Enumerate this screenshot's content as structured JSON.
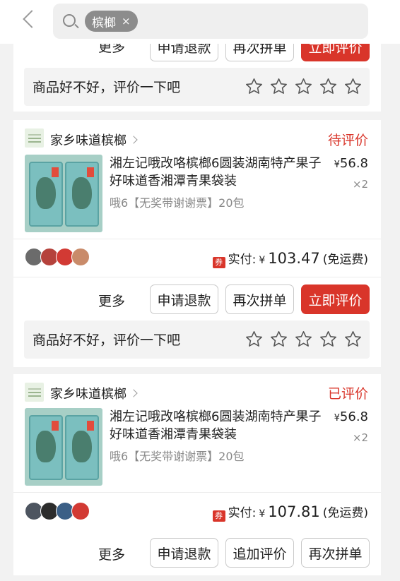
{
  "search": {
    "keyword": "槟榔",
    "clear": "×"
  },
  "top_card": {
    "more": "更多",
    "btn_refund": "申请退款",
    "btn_reorder": "再次拼单",
    "btn_review": "立即评价",
    "rate_prompt": "商品好不好，评价一下吧"
  },
  "orders": [
    {
      "shop_name": "家乡味道槟榔",
      "status": "待评价",
      "title": "湘左记哦改咯槟榔6圆装湖南特产果子好味道香湘潭青果袋装",
      "sku": "哦6【无奖带谢谢票】20包",
      "price_symbol": "¥",
      "price": "56.8",
      "qty": "×2",
      "paid_label": "实付:",
      "paid_symbol": "¥",
      "paid_amount": "103.47",
      "paid_note": "(免运费)",
      "coupon": "券",
      "more": "更多",
      "btn1": "申请退款",
      "btn2": "再次拼单",
      "btn3": "立即评价",
      "rate_prompt": "商品好不好，评价一下吧"
    },
    {
      "shop_name": "家乡味道槟榔",
      "status": "已评价",
      "title": "湘左记哦改咯槟榔6圆装湖南特产果子好味道香湘潭青果袋装",
      "sku": "哦6【无奖带谢谢票】20包",
      "price_symbol": "¥",
      "price": "56.8",
      "qty": "×2",
      "paid_label": "实付:",
      "paid_symbol": "¥",
      "paid_amount": "107.81",
      "paid_note": "(免运费)",
      "coupon": "券",
      "more": "更多",
      "btn1": "申请退款",
      "btn2": "追加评价",
      "btn3": "再次拼单"
    }
  ],
  "colors": {
    "accent": "#d9352a",
    "background": "#f2f2f2"
  },
  "icons": [
    "back-chevron-icon",
    "search-icon",
    "star-outline-icon",
    "coupon-icon",
    "chevron-right-icon"
  ]
}
